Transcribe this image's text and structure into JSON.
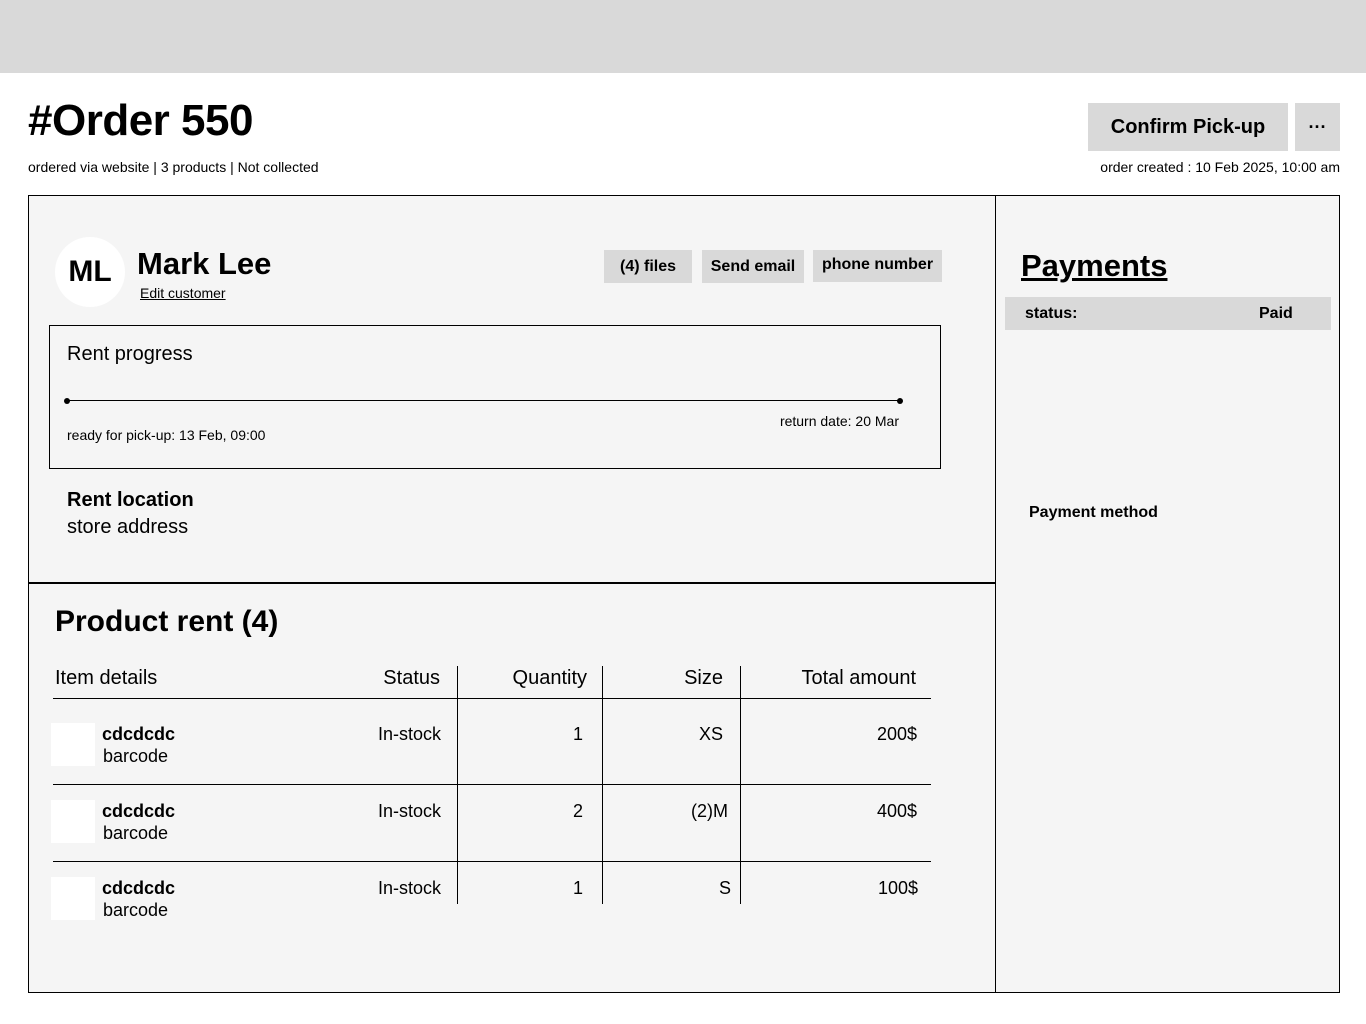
{
  "header": {
    "order_title": "#Order 550",
    "meta": "ordered via website | 3 products | Not collected",
    "confirm_label": "Confirm Pick-up",
    "more_label": "···",
    "order_created": "order created : 10 Feb 2025, 10:00 am"
  },
  "customer": {
    "initials": "ML",
    "name": "Mark Lee",
    "edit_label": "Edit customer",
    "files_label": "(4) files",
    "email_label": "Send email",
    "phone_label": "phone number"
  },
  "rent_progress": {
    "title": "Rent progress",
    "pickup": "ready for pick-up: 13 Feb, 09:00",
    "return": "return date: 20 Mar"
  },
  "rent_location": {
    "title": "Rent location",
    "value": "store address"
  },
  "products": {
    "title": "Product rent (4)",
    "columns": [
      "Item details",
      "Status",
      "Quantity",
      "Size",
      "Total amount"
    ],
    "rows": [
      {
        "name": "cdcdcdc",
        "code": "barcode",
        "status": "In-stock",
        "quantity": "1",
        "size": "XS",
        "total": "200$"
      },
      {
        "name": "cdcdcdc",
        "code": "barcode",
        "status": "In-stock",
        "quantity": "2",
        "size": "(2)M",
        "total": "400$"
      },
      {
        "name": "cdcdcdc",
        "code": "barcode",
        "status": "In-stock",
        "quantity": "1",
        "size": "S",
        "total": "100$"
      }
    ]
  },
  "payments": {
    "title": "Payments",
    "status_label": "status:",
    "status_value": "Paid",
    "method_label": "Payment method"
  }
}
